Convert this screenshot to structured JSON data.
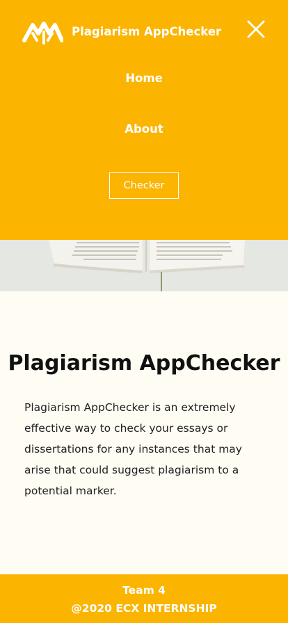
{
  "header": {
    "logo_icon": "mountain-logo-icon",
    "brand_name": "Plagiarism AppChecker",
    "close_icon": "close-icon",
    "background_color": "#fbb400"
  },
  "nav": {
    "items": [
      {
        "label": "Home"
      },
      {
        "label": "About"
      }
    ],
    "checker_button": "Checker"
  },
  "hero": {
    "image": "open-book-photo"
  },
  "main": {
    "title": "Plagiarism AppChecker",
    "description": " Plagiarism AppChecker is an extremely effective way to check your essays or dissertations for any instances that may arise that could suggest plagiarism to a potential marker."
  },
  "footer": {
    "team": "Team 4",
    "copyright": "@2020 ECX INTERNSHIP",
    "background_color": "#fbb400"
  }
}
